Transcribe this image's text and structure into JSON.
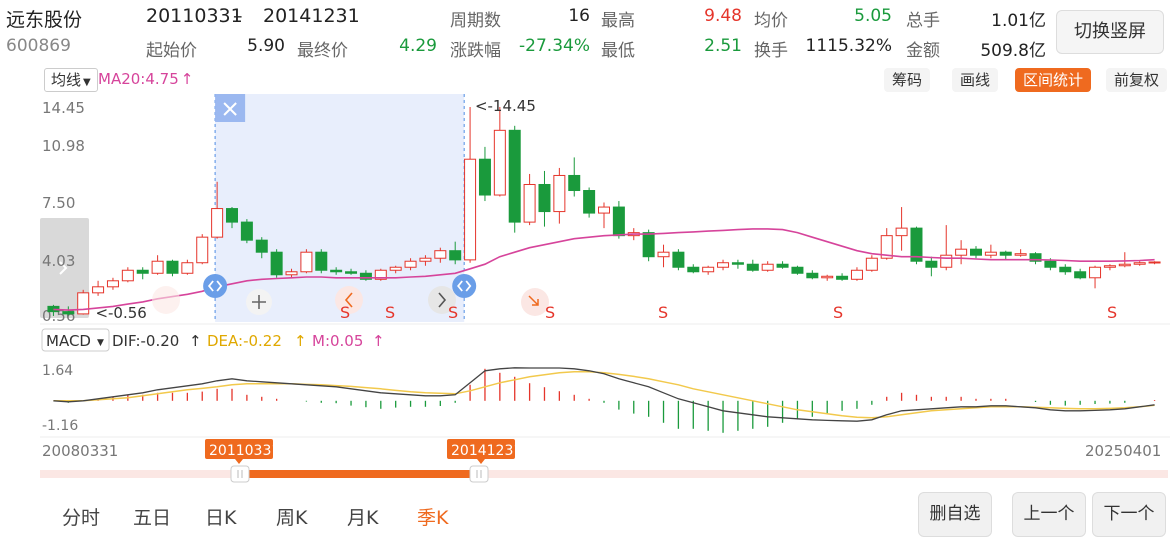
{
  "stock": {
    "name": "远东股份",
    "code": "600869",
    "date_from": "20110331",
    "date_to": "20141231",
    "dash": "–"
  },
  "stats": {
    "row1": [
      {
        "label": "周期数",
        "value": "16",
        "color": "#222222"
      },
      {
        "label": "最高",
        "value": "9.48",
        "color": "#e5352b"
      },
      {
        "label": "均价",
        "value": "5.05",
        "color": "#1a9a3c"
      },
      {
        "label": "总手",
        "value": "1.01亿",
        "color": "#222222"
      }
    ],
    "row2": [
      {
        "label": "起始价",
        "value": "5.90",
        "color": "#222222"
      },
      {
        "label": "最终价",
        "value": "4.29",
        "color": "#1a9a3c"
      },
      {
        "label": "涨跌幅",
        "value": "-27.34%",
        "color": "#1a9a3c"
      },
      {
        "label": "最低",
        "value": "2.51",
        "color": "#1a9a3c"
      },
      {
        "label": "换手",
        "value": "1115.32%",
        "color": "#222222"
      },
      {
        "label": "金额",
        "value": "509.8亿",
        "color": "#222222"
      }
    ]
  },
  "switch_button": "切换竖屏",
  "toolbar": {
    "ma_select": "均线",
    "ma_label": "MA20:4.75",
    "arrow_up": "↑",
    "chip": "筹码",
    "draw": "画线",
    "range_stats": "区间统计",
    "adjust": "前复权"
  },
  "price_axis": [
    "14.45",
    "10.98",
    "7.50",
    "4.03",
    "0.56"
  ],
  "annotations": {
    "high": "<-14.45",
    "low": "<-0.56"
  },
  "s_marks": [
    "S",
    "S",
    "S",
    "S",
    "S",
    "S",
    "S"
  ],
  "macd_bar": {
    "select": "MACD",
    "dif": "DIF:-0.20",
    "dea": "DEA:-0.22",
    "m": "M:0.05",
    "arrow_up": "↑"
  },
  "macd_axis": [
    "1.64",
    "-1.16"
  ],
  "date_axis": {
    "start": "20080331",
    "end": "20250401"
  },
  "range_badges": {
    "left": "20110331",
    "right": "20141231"
  },
  "period_tabs": [
    "分时",
    "五日",
    "日K",
    "周K",
    "月K",
    "季K"
  ],
  "active_period": "季K",
  "bottom_buttons": {
    "remove": "删自选",
    "prev": "上一个",
    "next": "下一个"
  },
  "colors": {
    "up": "#e5352b",
    "down": "#1a9a3c",
    "ma20": "#d6449b",
    "dif": "#444444",
    "dea": "#f2c94c",
    "selection": "#e8eefc",
    "accent": "#ef6a1f",
    "handle": "#6a9ee8"
  },
  "chart_data": {
    "type": "candlestick",
    "period": "quarterly",
    "ylim": [
      0.56,
      14.45
    ],
    "ohlc": [
      [
        1.2,
        1.3,
        0.56,
        0.85
      ],
      [
        0.85,
        1.2,
        0.6,
        0.7
      ],
      [
        0.7,
        2.3,
        0.65,
        2.1
      ],
      [
        2.1,
        2.9,
        1.9,
        2.5
      ],
      [
        2.5,
        3.1,
        2.3,
        2.9
      ],
      [
        2.9,
        3.8,
        2.8,
        3.6
      ],
      [
        3.6,
        3.8,
        3.0,
        3.4
      ],
      [
        3.4,
        4.6,
        3.3,
        4.2
      ],
      [
        4.2,
        4.3,
        3.2,
        3.4
      ],
      [
        3.4,
        4.3,
        3.3,
        4.1
      ],
      [
        4.1,
        6.0,
        4.0,
        5.8
      ],
      [
        5.8,
        9.48,
        5.7,
        7.7
      ],
      [
        7.7,
        7.8,
        6.4,
        6.8
      ],
      [
        6.8,
        7.0,
        5.4,
        5.6
      ],
      [
        5.6,
        5.8,
        4.4,
        4.8
      ],
      [
        4.8,
        5.0,
        3.1,
        3.3
      ],
      [
        3.3,
        3.7,
        3.1,
        3.5
      ],
      [
        3.5,
        5.0,
        3.4,
        4.8
      ],
      [
        4.8,
        5.0,
        3.4,
        3.6
      ],
      [
        3.6,
        3.8,
        3.3,
        3.5
      ],
      [
        3.5,
        3.7,
        3.3,
        3.4
      ],
      [
        3.4,
        3.6,
        2.9,
        3.0
      ],
      [
        3.0,
        3.7,
        2.9,
        3.6
      ],
      [
        3.6,
        3.9,
        3.4,
        3.8
      ],
      [
        3.8,
        4.4,
        3.6,
        4.2
      ],
      [
        4.2,
        4.6,
        3.9,
        4.4
      ],
      [
        4.4,
        5.1,
        4.1,
        4.9
      ],
      [
        4.9,
        5.5,
        4.0,
        4.29
      ],
      [
        4.29,
        14.45,
        4.1,
        10.98
      ],
      [
        10.98,
        11.8,
        8.2,
        8.6
      ],
      [
        8.6,
        14.45,
        8.5,
        12.9
      ],
      [
        12.9,
        13.2,
        6.1,
        6.8
      ],
      [
        6.8,
        10.0,
        6.6,
        9.3
      ],
      [
        9.3,
        10.2,
        6.5,
        7.5
      ],
      [
        7.5,
        10.4,
        6.7,
        9.9
      ],
      [
        9.9,
        11.1,
        8.5,
        8.9
      ],
      [
        8.9,
        9.1,
        7.1,
        7.4
      ],
      [
        7.4,
        8.1,
        6.4,
        7.8
      ],
      [
        7.8,
        8.2,
        5.7,
        5.9
      ],
      [
        5.9,
        6.4,
        5.6,
        6.1
      ],
      [
        6.1,
        6.3,
        4.2,
        4.5
      ],
      [
        4.5,
        5.3,
        3.8,
        4.8
      ],
      [
        4.8,
        5.0,
        3.6,
        3.8
      ],
      [
        3.8,
        4.0,
        3.4,
        3.5
      ],
      [
        3.5,
        3.9,
        3.3,
        3.8
      ],
      [
        3.8,
        4.3,
        3.6,
        4.1
      ],
      [
        4.1,
        4.3,
        3.7,
        4.0
      ],
      [
        4.0,
        4.3,
        3.5,
        3.6
      ],
      [
        3.6,
        4.2,
        3.5,
        4.0
      ],
      [
        4.0,
        4.2,
        3.7,
        3.8
      ],
      [
        3.8,
        3.9,
        3.3,
        3.4
      ],
      [
        3.4,
        3.6,
        3.0,
        3.1
      ],
      [
        3.1,
        3.3,
        2.9,
        3.2
      ],
      [
        3.2,
        3.4,
        2.9,
        3.0
      ],
      [
        3.0,
        3.8,
        2.9,
        3.6
      ],
      [
        3.6,
        4.6,
        3.5,
        4.4
      ],
      [
        4.4,
        6.4,
        4.3,
        5.9
      ],
      [
        5.9,
        7.8,
        4.9,
        6.4
      ],
      [
        6.4,
        6.5,
        4.0,
        4.2
      ],
      [
        4.2,
        4.5,
        3.2,
        3.8
      ],
      [
        3.8,
        6.6,
        3.6,
        4.6
      ],
      [
        4.6,
        5.6,
        4.0,
        5.0
      ],
      [
        5.0,
        5.2,
        4.4,
        4.6
      ],
      [
        4.6,
        5.3,
        4.4,
        4.8
      ],
      [
        4.8,
        4.9,
        4.3,
        4.6
      ],
      [
        4.6,
        5.0,
        4.5,
        4.7
      ],
      [
        4.7,
        4.8,
        4.0,
        4.2
      ],
      [
        4.2,
        4.4,
        3.6,
        3.8
      ],
      [
        3.8,
        4.0,
        3.3,
        3.5
      ],
      [
        3.5,
        3.7,
        3.0,
        3.1
      ],
      [
        3.1,
        3.9,
        2.4,
        3.8
      ],
      [
        3.8,
        4.0,
        3.6,
        3.9
      ],
      [
        3.9,
        4.8,
        3.8,
        4.0
      ],
      [
        4.0,
        4.2,
        3.9,
        4.1
      ],
      [
        4.1,
        4.2,
        4.0,
        4.15
      ]
    ],
    "ma20": [
      1.0,
      0.95,
      1.0,
      1.1,
      1.2,
      1.35,
      1.5,
      1.7,
      1.85,
      2.0,
      2.2,
      2.5,
      2.7,
      2.9,
      3.0,
      3.05,
      3.1,
      3.15,
      3.15,
      3.1,
      3.1,
      3.1,
      3.1,
      3.1,
      3.15,
      3.2,
      3.3,
      3.4,
      3.7,
      4.0,
      4.5,
      4.8,
      5.1,
      5.3,
      5.5,
      5.7,
      5.8,
      5.9,
      5.95,
      6.0,
      6.0,
      6.05,
      6.1,
      6.15,
      6.2,
      6.25,
      6.3,
      6.35,
      6.35,
      6.3,
      6.1,
      5.8,
      5.5,
      5.2,
      4.9,
      4.7,
      4.6,
      4.5,
      4.5,
      4.45,
      4.4,
      4.4,
      4.35,
      4.3,
      4.3,
      4.3,
      4.3,
      4.28,
      4.25,
      4.2,
      4.2,
      4.2,
      4.22,
      4.25,
      4.3
    ],
    "macd": {
      "ylim": [
        -1.16,
        1.64
      ],
      "dif": [
        0.0,
        -0.05,
        0.0,
        0.1,
        0.2,
        0.3,
        0.4,
        0.55,
        0.65,
        0.75,
        0.85,
        1.0,
        1.1,
        1.0,
        0.95,
        0.9,
        0.85,
        0.8,
        0.75,
        0.7,
        0.6,
        0.5,
        0.4,
        0.35,
        0.3,
        0.25,
        0.25,
        0.3,
        0.9,
        1.5,
        1.6,
        1.65,
        1.64,
        1.64,
        1.64,
        1.6,
        1.5,
        1.35,
        1.1,
        0.9,
        0.7,
        0.4,
        0.1,
        -0.1,
        -0.3,
        -0.5,
        -0.6,
        -0.7,
        -0.8,
        -0.85,
        -0.9,
        -0.95,
        -0.98,
        -1.0,
        -1.02,
        -0.95,
        -0.7,
        -0.5,
        -0.45,
        -0.4,
        -0.35,
        -0.3,
        -0.3,
        -0.25,
        -0.25,
        -0.3,
        -0.35,
        -0.45,
        -0.5,
        -0.5,
        -0.48,
        -0.45,
        -0.4,
        -0.3,
        -0.2
      ],
      "dea": [
        0.0,
        0.0,
        0.0,
        0.05,
        0.1,
        0.15,
        0.25,
        0.35,
        0.45,
        0.55,
        0.62,
        0.7,
        0.8,
        0.85,
        0.85,
        0.85,
        0.85,
        0.82,
        0.8,
        0.76,
        0.72,
        0.66,
        0.6,
        0.52,
        0.45,
        0.4,
        0.38,
        0.35,
        0.5,
        0.7,
        0.9,
        1.05,
        1.2,
        1.3,
        1.4,
        1.45,
        1.45,
        1.4,
        1.32,
        1.22,
        1.1,
        0.95,
        0.8,
        0.6,
        0.45,
        0.3,
        0.15,
        0.0,
        -0.15,
        -0.3,
        -0.45,
        -0.55,
        -0.65,
        -0.75,
        -0.82,
        -0.85,
        -0.8,
        -0.7,
        -0.6,
        -0.5,
        -0.45,
        -0.4,
        -0.35,
        -0.3,
        -0.3,
        -0.3,
        -0.32,
        -0.35,
        -0.38,
        -0.4,
        -0.4,
        -0.38,
        -0.35,
        -0.3,
        -0.22
      ]
    }
  }
}
